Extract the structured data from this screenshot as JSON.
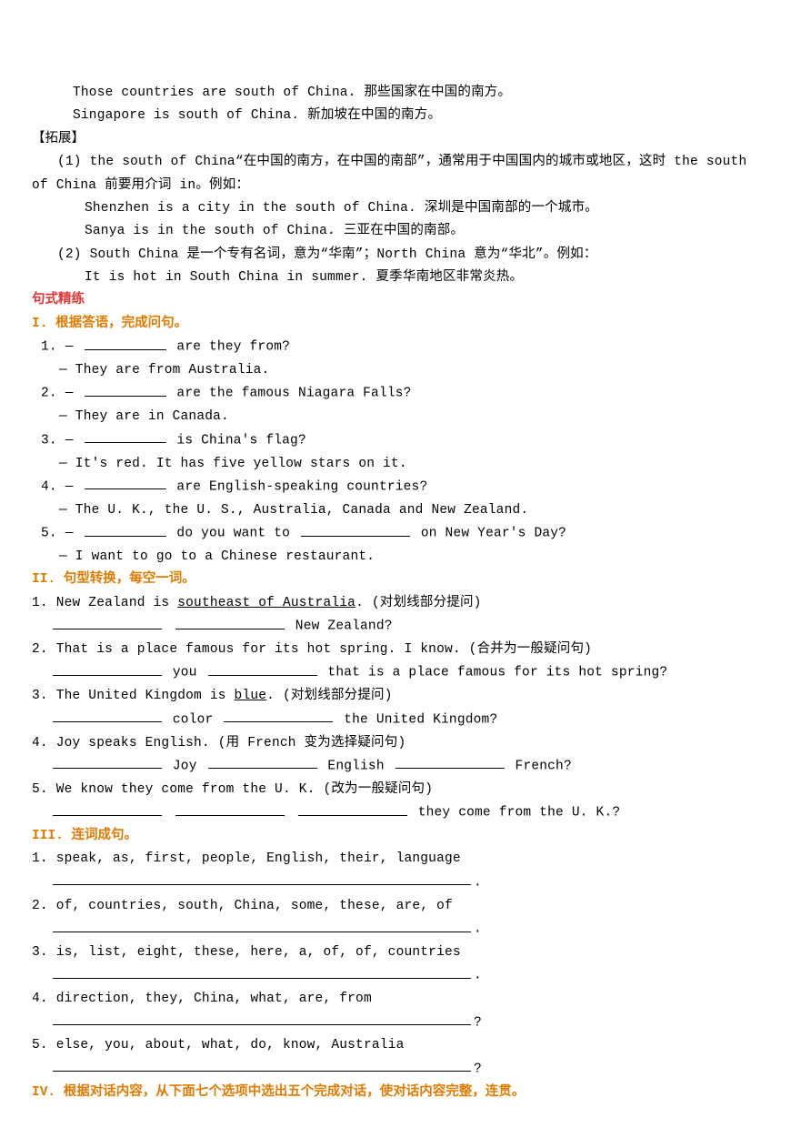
{
  "top": {
    "line1_en": "Those countries are south of China.",
    "line1_zh": " 那些国家在中国的南方。",
    "line2_en": "Singapore is south of China.",
    "line2_zh": " 新加坡在中国的南方。"
  },
  "expansion": {
    "label": "【拓展】",
    "p1_a": "(1) the south of China“在中国的南方，在中国的南部”，通常用于中国国内的城市或地区，这时 the south",
    "p1_b": "of China 前要用介词 in。例如：",
    "ex1_en": "Shenzhen is a city in the south of China.",
    "ex1_zh": " 深圳是中国南部的一个城市。",
    "ex2_en": "Sanya is in the south of China.",
    "ex2_zh": " 三亚在中国的南部。",
    "p2": "(2) South China 是一个专有名词，意为“华南”；North China 意为“华北”。例如：",
    "ex3_en": "It is hot in South China in summer.",
    "ex3_zh": " 夏季华南地区非常炎热。"
  },
  "headers": {
    "practice": "句式精练",
    "s1": "I. 根据答语，完成问句。",
    "s2": "II. 句型转换，每空一词。",
    "s3": "III. 连词成句。",
    "s4": "IV. 根据对话内容，从下面七个选项中选出五个完成对话，使对话内容完整，连贯。"
  },
  "s1": {
    "q1_q": " are they from?",
    "q1_a": "— They are from Australia.",
    "q2_q": " are the famous Niagara Falls?",
    "q2_a": "— They are in Canada.",
    "q3_q": " is China's flag?",
    "q3_a": "— It's red. It has five yellow stars on it.",
    "q4_q": " are English-speaking countries?",
    "q4_a": "— The U. K., the U. S., Australia, Canada and New Zealand.",
    "q5_q_a": " do you want to ",
    "q5_q_b": " on New Year's Day?",
    "q5_a": "— I want to go to a Chinese restaurant."
  },
  "s2": {
    "q1_a": "1. New Zealand is ",
    "q1_u": "southeast of Australia",
    "q1_b": ". (对划线部分提问)",
    "q1_tail": " New Zealand?",
    "q2_a": "2. That is a place famous for its hot spring. I know. (合并为一般疑问句)",
    "q2_mid": " you ",
    "q2_tail": " that is a place famous for its hot spring?",
    "q3_a": "3. The United Kingdom is ",
    "q3_u": "blue",
    "q3_b": ". (对划线部分提问)",
    "q3_mid": " color ",
    "q3_tail": " the United Kingdom?",
    "q4_a": "4. Joy speaks English. (用 French 变为选择疑问句)",
    "q4_p1": " Joy ",
    "q4_p2": " English ",
    "q4_p3": " French?",
    "q5_a": "5. We know they come from the U. K. (改为一般疑问句)",
    "q5_tail": " they come from the U. K.?"
  },
  "s3": {
    "q1": "1. speak, as, first, people, English, their, language",
    "q2": "2. of, countries, south, China, some, these, are, of",
    "q3": "3. is, list, eight, these, here, a, of, of, countries",
    "q4": "4. direction, they, China, what, are, from",
    "q5": "5. else, you, about, what, do, know, Australia",
    "period": ".",
    "qmark": "?"
  }
}
